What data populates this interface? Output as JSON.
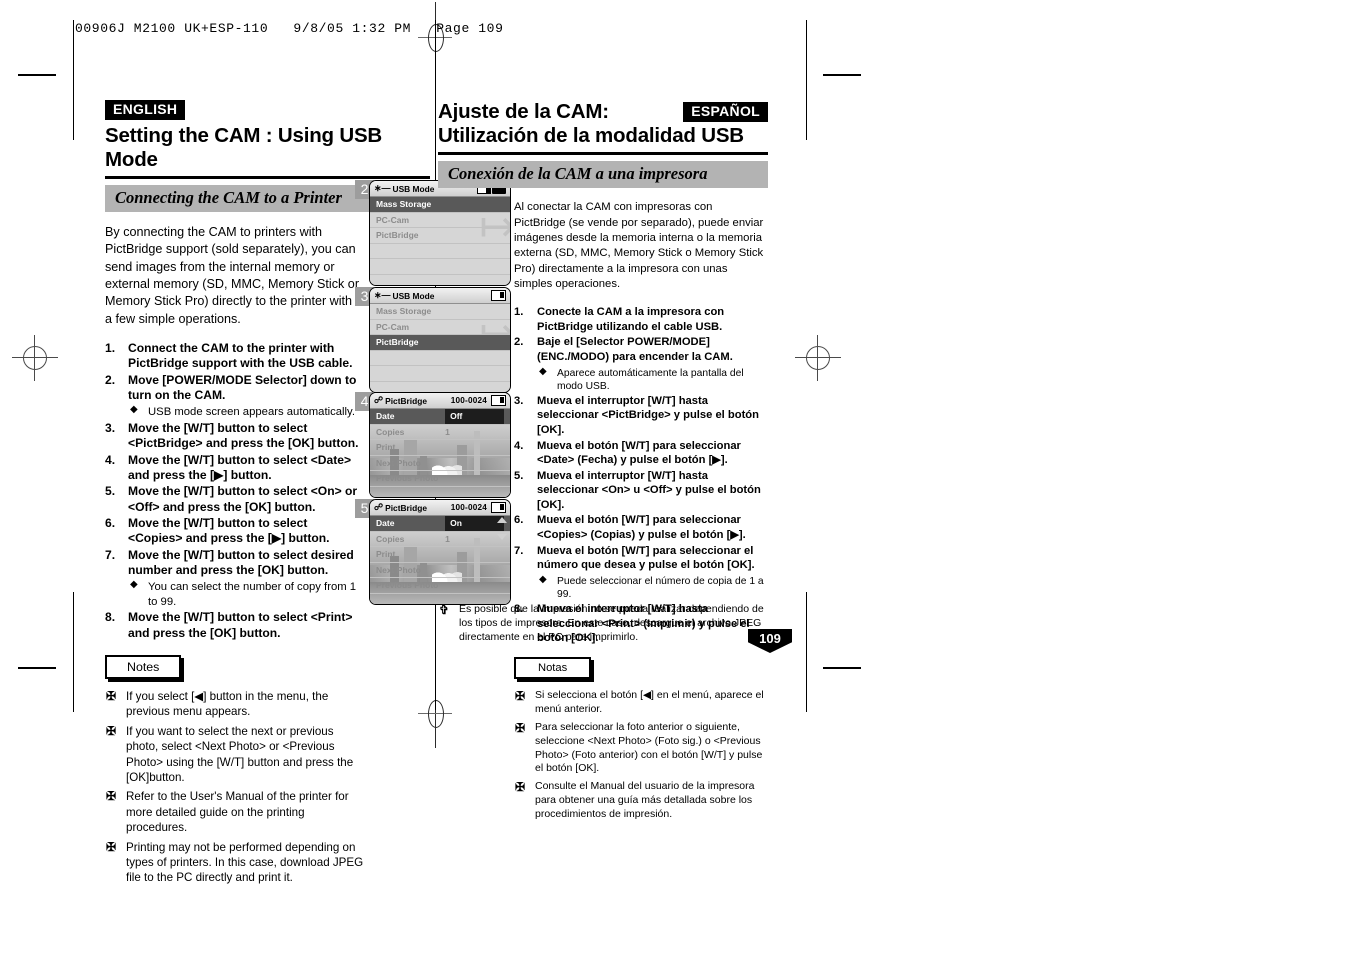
{
  "slug": "00906J M2100 UK+ESP-110   9/8/05 1:32 PM   Page 109",
  "page_number": "109",
  "english": {
    "badge": "ENGLISH",
    "title_line1": "Setting the CAM : Using USB Mode",
    "section_bar": "Connecting the CAM to a Printer",
    "intro": "By connecting the CAM to printers with PictBridge support (sold separately), you can send images from the internal memory or external memory (SD, MMC, Memory Stick or Memory Stick Pro) directly to the printer with a few simple operations.",
    "steps": [
      {
        "num": "1.",
        "text": "Connect the CAM to the printer with PictBridge support with the USB cable.",
        "bullets": []
      },
      {
        "num": "2.",
        "text": "Move [POWER/MODE Selector] down to turn on the CAM.",
        "bullets": [
          "USB mode screen appears automatically."
        ]
      },
      {
        "num": "3.",
        "text": "Move the [W/T] button to select <PictBridge> and press the [OK] button.",
        "bullets": []
      },
      {
        "num": "4.",
        "text": "Move the [W/T] button to select <Date> and press the [▶] button.",
        "bullets": []
      },
      {
        "num": "5.",
        "text": "Move the [W/T] button to select <On> or <Off> and press the [OK] button.",
        "bullets": []
      },
      {
        "num": "6.",
        "text": "Move the [W/T] button to select <Copies> and press the [▶] button.",
        "bullets": []
      },
      {
        "num": "7.",
        "text": "Move the [W/T] button to select desired number and press the [OK] button.",
        "bullets": [
          "You can select the number of copy from 1 to 99."
        ]
      },
      {
        "num": "8.",
        "text": "Move the [W/T] button to select <Print> and press the [OK] button.",
        "bullets": []
      }
    ],
    "notes_label": "Notes",
    "notes": [
      "If you select [◀] button in the menu, the previous menu appears.",
      "If you want to select the next or previous photo, select <Next Photo> or <Previous Photo> using the [W/T] button and press the [OK]button.",
      "Refer to the User's Manual of the printer for more detailed guide on the printing procedures.",
      "Printing may not be performed depending on types of printers. In this case, download JPEG file to the PC directly and print it."
    ]
  },
  "spanish": {
    "badge": "ESPAÑOL",
    "title_line1": "Ajuste de la CAM:",
    "title_line2": "Utilización de la modalidad USB",
    "section_bar": "Conexión de la CAM a una impresora",
    "intro": "Al conectar la CAM con impresoras con PictBridge (se vende por separado), puede enviar imágenes desde la memoria interna o la memoria externa (SD, MMC, Memory Stick o Memory Stick Pro) directamente a la impresora con unas simples operaciones.",
    "steps": [
      {
        "num": "1.",
        "text": "Conecte la CAM a la impresora con PictBridge utilizando el cable USB.",
        "bullets": []
      },
      {
        "num": "2.",
        "text": "Baje el [Selector POWER/MODE] (ENC./MODO) para encender la CAM.",
        "bullets": [
          "Aparece automáticamente la pantalla del modo USB."
        ]
      },
      {
        "num": "3.",
        "text": "Mueva el interruptor [W/T] hasta seleccionar <PictBridge> y pulse el botón [OK].",
        "bullets": []
      },
      {
        "num": "4.",
        "text": "Mueva el botón [W/T] para seleccionar <Date> (Fecha) y pulse el botón [▶].",
        "bullets": []
      },
      {
        "num": "5.",
        "text": "Mueva el interruptor [W/T] hasta seleccionar <On> u <Off> y pulse el botón [OK].",
        "bullets": []
      },
      {
        "num": "6.",
        "text": "Mueva el botón [W/T] para seleccionar <Copies> (Copias) y pulse el botón [▶].",
        "bullets": []
      },
      {
        "num": "7.",
        "text": "Mueva el botón [W/T] para seleccionar el número que desea y pulse el botón [OK].",
        "bullets": [
          "Puede seleccionar el número de copia de 1 a 99."
        ]
      },
      {
        "num": "8.",
        "text": "Mueva el interruptor [W/T] hasta seleccionar <Print> (Imprimir) y pulse el botón [OK].",
        "bullets": []
      }
    ],
    "notes_label": "Notas",
    "notes": [
      "Si selecciona el botón [◀] en el menú, aparece el menú anterior.",
      "Para seleccionar la foto anterior o siguiente, seleccione <Next Photo> (Foto sig.) o <Previous Photo> (Foto anterior) con el botón [W/T] y pulse el botón [OK].",
      "Consulte el Manual del usuario de la impresora para obtener una guía más detallada sobre los procedimientos de impresión."
    ],
    "note_wide": "Es posible que la impresión no se pueda realizar dependiendo de los tipos de impresora. En este caso, descargue el archivo JPEG directamente en el PC para imprimirlo."
  },
  "screens": [
    {
      "step": "2",
      "header_title": "USB Mode",
      "header_icon": "usb-icon",
      "header_right": "battery-icon",
      "rows": [
        {
          "label": "Mass Storage",
          "selected": true
        },
        {
          "label": "PC-Cam",
          "selected": false
        },
        {
          "label": "PictBridge",
          "selected": false
        }
      ]
    },
    {
      "step": "3",
      "header_title": "USB Mode",
      "header_icon": "usb-icon",
      "header_right": "card-icon",
      "rows": [
        {
          "label": "Mass Storage",
          "selected": false
        },
        {
          "label": "PC-Cam",
          "selected": false
        },
        {
          "label": "PictBridge",
          "selected": true
        }
      ]
    },
    {
      "step": "4",
      "header_title": "PictBridge",
      "header_file": "100-0024",
      "header_icon": "pictbridge-icon",
      "header_right": "card-icon",
      "menu": [
        {
          "label": "Date",
          "value": "Off",
          "selected": true
        },
        {
          "label": "Copies",
          "value": "1",
          "selected": false
        },
        {
          "label": "Print",
          "value": "",
          "selected": false
        },
        {
          "label": "Next Photo",
          "value": "",
          "selected": false
        },
        {
          "label": "Previous Photo",
          "value": "",
          "selected": false
        }
      ],
      "arrows": false
    },
    {
      "step": "5",
      "header_title": "PictBridge",
      "header_file": "100-0024",
      "header_icon": "pictbridge-icon",
      "header_right": "card-icon",
      "menu": [
        {
          "label": "Date",
          "value": "On",
          "selected": true
        },
        {
          "label": "Copies",
          "value": "1",
          "selected": false
        },
        {
          "label": "Print",
          "value": "",
          "selected": false
        },
        {
          "label": "Next Photo",
          "value": "",
          "selected": false
        },
        {
          "label": "Previous Photo",
          "value": "",
          "selected": false
        }
      ],
      "arrows": true
    }
  ]
}
